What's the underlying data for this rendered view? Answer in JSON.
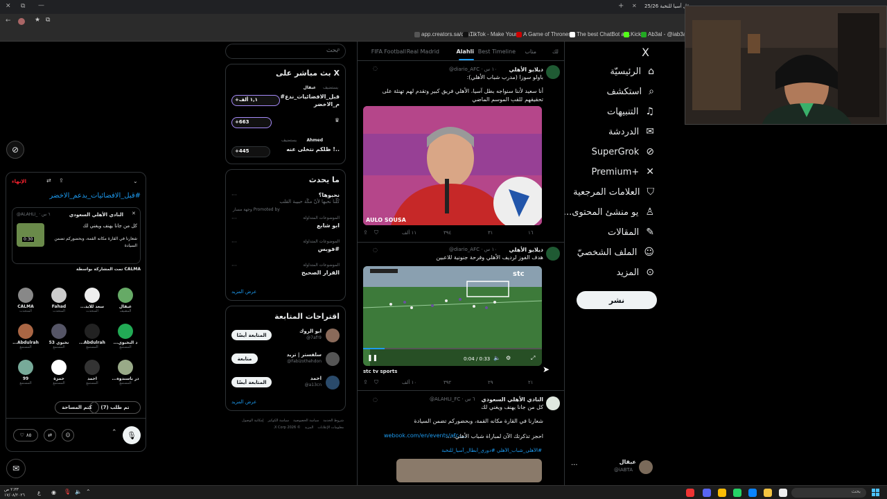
{
  "browser": {
    "tab_title": "25/26 قل أسيا للنخبة...",
    "bookmarks": [
      {
        "label": "app.creators.sa/das...",
        "color": "#555"
      },
      {
        "label": "TikTok - Make Your...",
        "color": "#111"
      },
      {
        "label": "A Game of Thrones...",
        "color": "#c00"
      },
      {
        "label": "The best ChatBot an...",
        "color": "#fff"
      },
      {
        "label": "Kick",
        "color": "#53fc18"
      },
      {
        "label": "Ab3al - @iab3al |...",
        "color": "#2a2"
      }
    ]
  },
  "nav": {
    "logo": "X",
    "items": [
      {
        "label": "الرئيسيّة",
        "icon": "home-icon"
      },
      {
        "label": "استكشف",
        "icon": "search-icon"
      },
      {
        "label": "التنبيهات",
        "icon": "bell-icon"
      },
      {
        "label": "الدردشة",
        "icon": "mail-icon"
      },
      {
        "label": "SuperGrok",
        "icon": "grok-icon"
      },
      {
        "label": "Premium+",
        "icon": "x-icon"
      },
      {
        "label": "العلامات المرجعية",
        "icon": "bookmark-icon"
      },
      {
        "label": "...يو منشئ المحتوى",
        "icon": "creator-icon"
      },
      {
        "label": "المقالات",
        "icon": "article-icon"
      },
      {
        "label": "الملف الشخصيّ",
        "icon": "user-icon"
      },
      {
        "label": "المزيد",
        "icon": "more-icon"
      }
    ],
    "post_button": "نشر",
    "account_name": "عبقال",
    "account_handle": "@iABTA"
  },
  "feed": {
    "tabs": [
      "لك",
      "متاب",
      "Best Timeline",
      "Alahli",
      "Real Madrid",
      "Football",
      "FIFA"
    ],
    "active_tab": "Alahli",
    "posts": [
      {
        "name": "ديلايو الأهلي",
        "handle": "@diario_AFC · ١٠ س",
        "text": [
          "باولو سوزا (مدرب شباب الأهلي):",
          "أنا سعيد لأننا سنواجه بطل آسيا، الأهلي فريق كبير وتقدم لهم تهنئة على تحقيقهم",
          "للقب الموسم الماضي"
        ],
        "image_caption": "AULO SOUSA",
        "metrics": {
          "replies": "١٦",
          "reposts": "٣١",
          "likes": "٣٩٤",
          "views": "١١ ألف"
        }
      },
      {
        "name": "ديلايو الأهلي",
        "handle": "@diario_AFC · ١٠ س",
        "text": [
          "هدف الفوز لرديف الأهلي وفرحة جنونية للاعبين"
        ],
        "video_time": "0:04 / 0:33",
        "video_brand": "stc",
        "source": "stc tv sports",
        "metrics": {
          "replies": "٢١",
          "reposts": "٢٩",
          "likes": "٣٩٢",
          "views": "١٠ ألف"
        }
      },
      {
        "name": "النادي الأهلي السعودي",
        "handle": "@ALAHLI_FC · ٦ س",
        "text": [
          "كل من جانا يهنف ويغني لك",
          "شعارنا في القارة مكانه القمة، وبحضوركم تضمن السيادة",
          "احجز تذكرتك الآن لمباراة شباب الأهلي: ..."
        ],
        "link": "webook.com/en/events/afc-...",
        "hashtags": "#الأهلي_شباب_الأهلي #دوري_أبطال_آسيا_للنخبة"
      }
    ]
  },
  "search": {
    "placeholder": "بحث"
  },
  "live": {
    "title": "X بث مباشر على",
    "items": [
      {
        "host": "عبقال",
        "role": "يستضيف",
        "title": "قبل_الافضائيات_ندع#",
        "title2": "م_الاخضر",
        "count": "+١,١ ألف"
      },
      {
        "host": "",
        "role": "",
        "title": "",
        "title2": "",
        "count": "+663"
      },
      {
        "host": "Ahmed",
        "role": "يستضيف",
        "title": "..! ظلكم نتخلى عنه",
        "title2": "",
        "count": "+445"
      }
    ]
  },
  "trends": {
    "title": "ما يحدث",
    "items": [
      {
        "category": "نحبوها؟",
        "name": "كُلّنا نحبها لأنّ مكّة حبيبة القلب",
        "meta": "Promoted by وجهة مسار"
      },
      {
        "category": "الموضوعات المتداولة",
        "name": "ابو شابع",
        "meta": ""
      },
      {
        "category": "الموضوعات المتداولة",
        "name": "#فوبس",
        "meta": ""
      },
      {
        "category": "الموضوعات المتداولة",
        "name": "القرار الصحيح",
        "meta": ""
      }
    ],
    "show_more": "عرض المزيد"
  },
  "follow": {
    "title": "اقتراحات المتابعة",
    "items": [
      {
        "name": "ابو الروك",
        "handle": "@7af!9",
        "button": "المتابعة أيضًا"
      },
      {
        "name": "سلفستر | تريد",
        "handle": "@Fabizothehdon",
        "button": "متابعة"
      },
      {
        "name": "احمد",
        "handle": "@a13cn",
        "button": "المتابعة أيضًا"
      }
    ],
    "show_more": "عرض المزيد"
  },
  "footer_links": [
    "شروط الخدمة",
    "سياسة الخصوصية",
    "سياسة الكوكيز",
    "إمكانية الوصول",
    "معلومات الإعلانات",
    "المزيد",
    "© 2026 X Corp."
  ],
  "spaces": {
    "end_label": "الإنهاء",
    "hashtag": "#قبل_الافضائيات_بدعم_الاخضر",
    "card_name": "النادي الأهلي السعودي",
    "card_handle": "@ALAHLI_ · ٦ س",
    "card_text1": "كل من جانا يهنف ويغني لك",
    "card_text2": "شعارنا في القارة مكانه القمة، وبحضوركم تضمن السيادة",
    "card_duration": "0:30",
    "shared_by": "CALMA تمت المشاركة بواسطة",
    "people": [
      {
        "name": "عبقال",
        "role": "المضيف",
        "color": "#6a6"
      },
      {
        "name": "...سعد للابد",
        "role": "المتحدث",
        "color": "#eee"
      },
      {
        "name": "Fahad",
        "role": "المتحدث",
        "color": "#ccc"
      },
      {
        "name": "CALMA",
        "role": "المتحدث",
        "color": "#888"
      },
      {
        "name": "...د النخبوي",
        "role": "المستمع",
        "color": "#2a5"
      },
      {
        "name": "...Abdulrah",
        "role": "المستمع",
        "color": "#222"
      },
      {
        "name": "53 نخبوي",
        "role": "المستمع",
        "color": "#556"
      },
      {
        "name": "...Abdulrah",
        "role": "المستمع",
        "color": "#a64"
      },
      {
        "name": "...در باسندوه",
        "role": "المستمع",
        "color": "#9a8"
      },
      {
        "name": "احمد",
        "role": "المستمع",
        "color": "#333"
      },
      {
        "name": "حمزة",
        "role": "المستمع",
        "color": "#fff"
      },
      {
        "name": "99",
        "role": "المستمع",
        "color": "#7a9"
      }
    ],
    "request_btn": "تم طلب (7)",
    "mute_btn": "كتم المساحة",
    "likes": "٨٥"
  },
  "taskbar": {
    "time": "٢:٣٣ ص",
    "date": "١٧/٠٨/٢٠٢٦",
    "search": "بحث"
  }
}
